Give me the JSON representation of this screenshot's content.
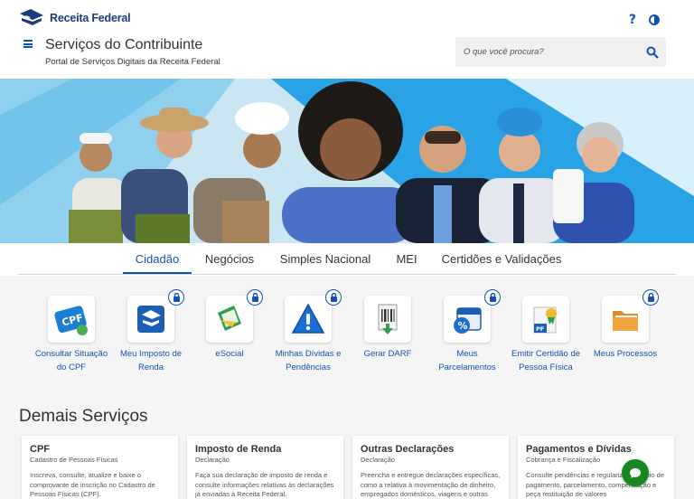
{
  "brand": {
    "name": "Receita Federal"
  },
  "header": {
    "title": "Serviços do Contribuinte",
    "subtitle": "Portal de Serviços Digitais da Receita Federal",
    "help_icon": "question-mark-icon",
    "contrast_icon": "contrast-icon",
    "menu_icon": "hamburger-menu-icon"
  },
  "search": {
    "placeholder": "O que você procura?",
    "icon": "search-icon"
  },
  "tabs": [
    {
      "label": "Cidadão",
      "active": true
    },
    {
      "label": "Negócios",
      "active": false
    },
    {
      "label": "Simples Nacional",
      "active": false
    },
    {
      "label": "MEI",
      "active": false
    },
    {
      "label": "Certidões e Validações",
      "active": false
    }
  ],
  "services": [
    {
      "label": "Consultar Situação do CPF",
      "icon": "cpf-card-icon",
      "locked": false
    },
    {
      "label": "Meu Imposto de Renda",
      "icon": "income-tax-icon",
      "locked": true
    },
    {
      "label": "eSocial",
      "icon": "esocial-icon",
      "locked": true
    },
    {
      "label": "Minhas Dívidas e Pendências",
      "icon": "warning-icon",
      "locked": true
    },
    {
      "label": "Gerar DARF",
      "icon": "darf-barcode-icon",
      "locked": false
    },
    {
      "label": "Meus Parcelamentos",
      "icon": "calendar-percent-icon",
      "locked": true
    },
    {
      "label": "Emitir Certidão de Pessoa Física",
      "icon": "certificate-icon",
      "locked": false
    },
    {
      "label": "Meus Processos",
      "icon": "folder-icon",
      "locked": true
    }
  ],
  "demais": {
    "title": "Demais Serviços",
    "cards": [
      {
        "title": "CPF",
        "subtitle": "Cadastro de Pessoas Físicas",
        "desc": "Inscreva, consulte, atualize e baixe o comprovante de inscrição no Cadastro de Pessoas Físicas (CPF)."
      },
      {
        "title": "Imposto de Renda",
        "subtitle": "Declaração",
        "desc": "Faça sua declaração de imposto de renda e consulte informações relativas às declarações já enviadas à Receita Federal."
      },
      {
        "title": "Outras Declarações",
        "subtitle": "Declaração",
        "desc": "Preencha e entregue declarações específicas, como a relativa à movimentação de dinheiro, empregados domésticos, viagens e outras"
      },
      {
        "title": "Pagamentos e Dívidas",
        "subtitle": "Cobrança e Fiscalização",
        "desc": "Consulte pendências e regularize por meio de pagamento, parcelamento, compensação e peça restituição de valores"
      }
    ]
  },
  "chat": {
    "icon": "chat-bubble-icon"
  },
  "colors": {
    "primary": "#1351b4",
    "brand_dark": "#1a3c7a",
    "banner_light": "#bfe0ee",
    "banner_blue": "#2aa3e6",
    "chat_green": "#168821"
  }
}
